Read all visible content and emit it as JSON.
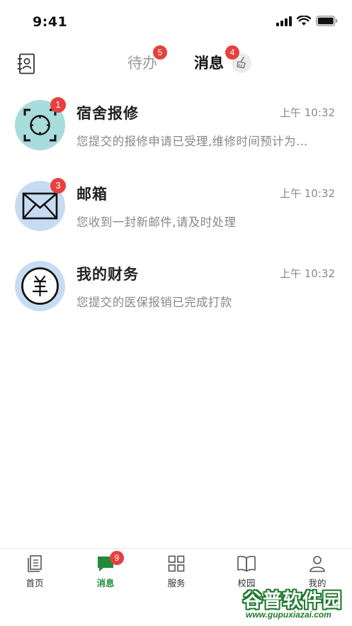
{
  "status_bar": {
    "time": "9:41"
  },
  "header": {
    "tabs": [
      {
        "label": "待办",
        "badge": "5"
      },
      {
        "label": "消息",
        "badge": "4"
      }
    ]
  },
  "messages": [
    {
      "title": "宿舍报修",
      "time": "上午 10:32",
      "preview": "您提交的报修申请已受理,维修时间预计为…",
      "badge": "1",
      "icon": "scan-frame-icon",
      "avatar_color": "#a9dcdc"
    },
    {
      "title": "邮箱",
      "time": "上午 10:32",
      "preview": "您收到一封新邮件,请及时处理",
      "badge": "3",
      "icon": "envelope-icon",
      "avatar_color": "#c7dcf3"
    },
    {
      "title": "我的财务",
      "time": "上午 10:32",
      "preview": "您提交的医保报销已完成打款",
      "badge": "",
      "icon": "yuan-icon",
      "avatar_color": "#c7dcf3"
    }
  ],
  "tabbar": {
    "items": [
      {
        "label": "首页",
        "icon": "document-icon"
      },
      {
        "label": "消息",
        "icon": "chat-bubble-icon",
        "badge": "9",
        "active": true
      },
      {
        "label": "服务",
        "icon": "grid-icon"
      },
      {
        "label": "校园",
        "icon": "book-icon"
      },
      {
        "label": "我的",
        "icon": "person-icon"
      }
    ]
  },
  "colors": {
    "accent": "#1f8c3c",
    "badge": "#e6403f",
    "muted_text": "#888888"
  },
  "watermark": {
    "text": "谷普软件园",
    "url": "www.gupuxiazai.com"
  }
}
